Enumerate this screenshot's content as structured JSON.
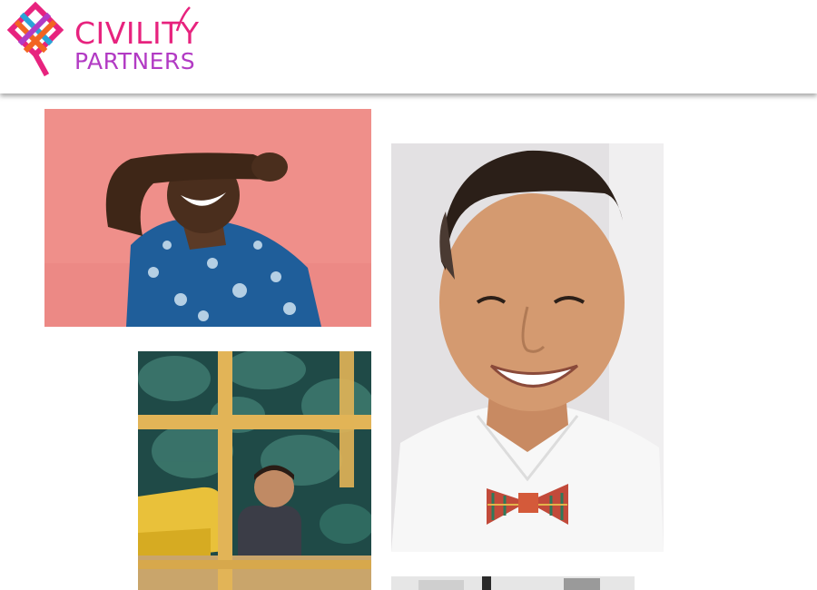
{
  "brand": {
    "line1": "CIVILITY",
    "line2": "PARTNERS",
    "colors": {
      "pink": "#e7237e",
      "purple": "#b23bc4",
      "orange": "#f26522",
      "blue": "#2aa3d8"
    }
  },
  "gallery": {
    "photos": [
      {
        "name": "laughing-man-photo"
      },
      {
        "name": "smiling-person-bowtie-photo"
      },
      {
        "name": "office-meeting-photo"
      },
      {
        "name": "partial-photo"
      }
    ]
  }
}
